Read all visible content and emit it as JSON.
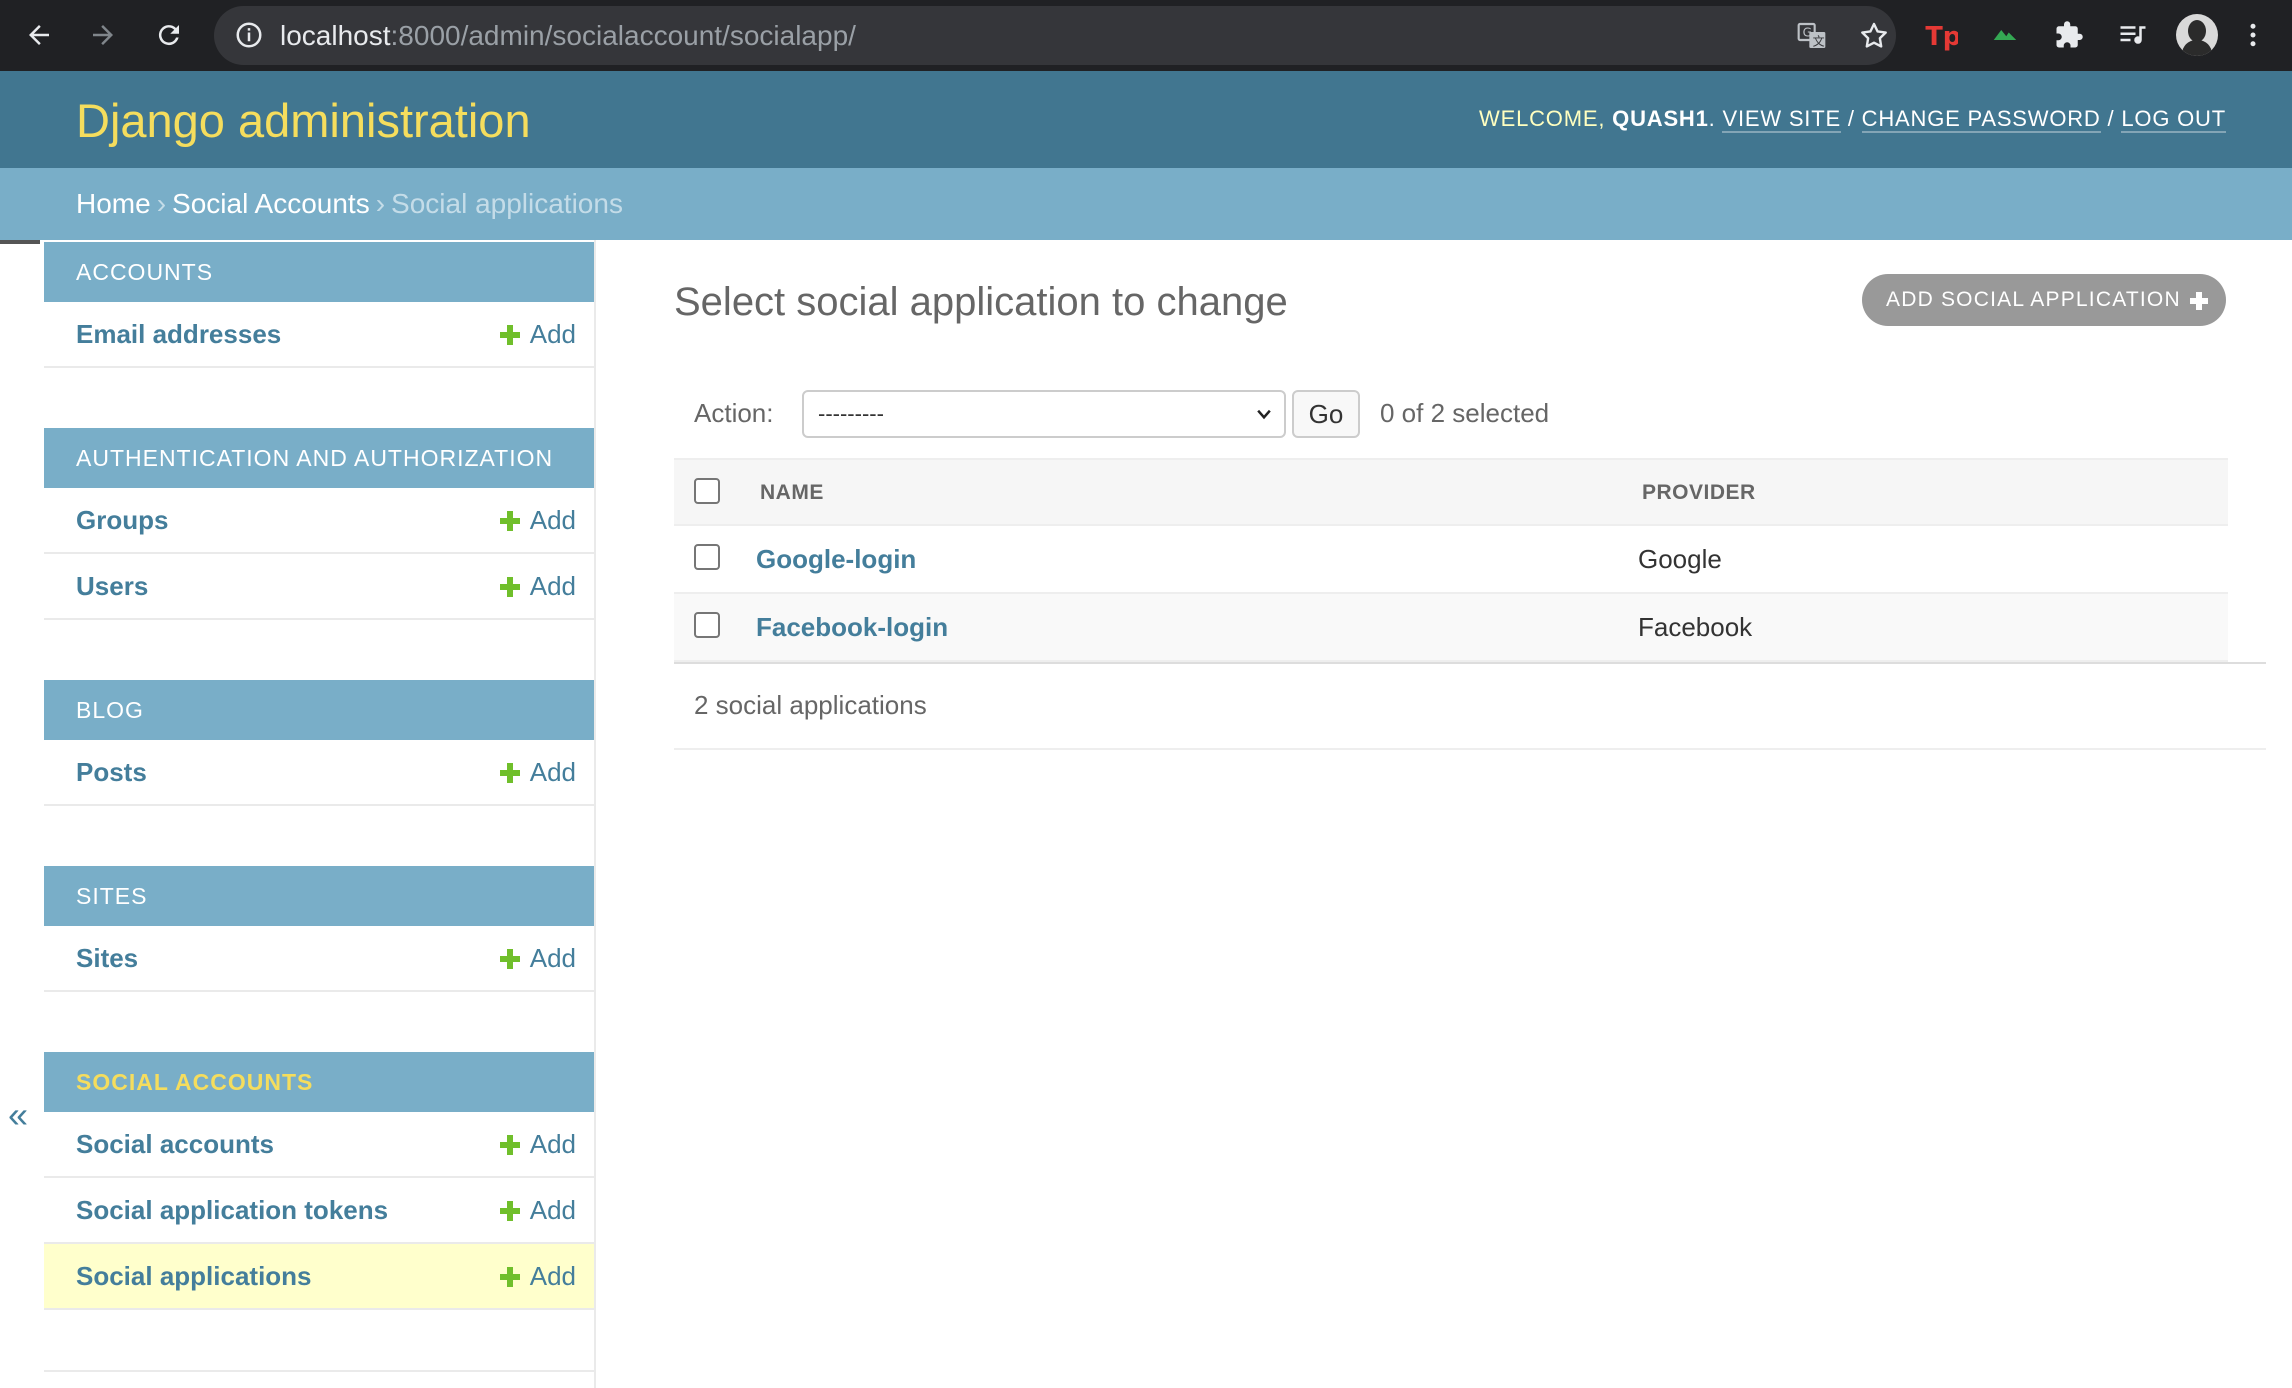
{
  "browser": {
    "url_host": "localhost",
    "url_rest": ":8000/admin/socialaccount/socialapp/"
  },
  "header": {
    "branding": "Django administration",
    "welcome": "Welcome,",
    "username": "quash1",
    "view_site": "View site",
    "change_password": "Change password",
    "log_out": "Log out"
  },
  "breadcrumbs": {
    "home": "Home",
    "app": "Social Accounts",
    "current": "Social applications",
    "separator": "›"
  },
  "sidebar": {
    "toggle": "«",
    "add_label": "Add",
    "modules": [
      {
        "caption": "Accounts",
        "models": [
          {
            "name": "Email addresses"
          }
        ]
      },
      {
        "caption": "Authentication and Authorization",
        "models": [
          {
            "name": "Groups"
          },
          {
            "name": "Users"
          }
        ]
      },
      {
        "caption": "Blog",
        "models": [
          {
            "name": "Posts"
          }
        ]
      },
      {
        "caption": "Sites",
        "models": [
          {
            "name": "Sites"
          }
        ]
      },
      {
        "caption": "Social Accounts",
        "models": [
          {
            "name": "Social accounts"
          },
          {
            "name": "Social application tokens"
          },
          {
            "name": "Social applications"
          }
        ]
      }
    ]
  },
  "content": {
    "title": "Select social application to change",
    "add_button": "Add social application",
    "action_label": "Action:",
    "action_selected": "---------",
    "go_button": "Go",
    "selection_count": "0 of 2 selected",
    "columns": {
      "name": "Name",
      "provider": "Provider"
    },
    "rows": [
      {
        "name": "Google-login",
        "provider": "Google"
      },
      {
        "name": "Facebook-login",
        "provider": "Facebook"
      }
    ],
    "paginator": "2 social applications"
  },
  "colors": {
    "header_bg": "#417690",
    "breadcrumbs_bg": "#79aec8",
    "branding": "#f5dd5d",
    "link": "#447e9b",
    "add_plus": "#70bf2b",
    "current_row": "#ffffcc"
  }
}
